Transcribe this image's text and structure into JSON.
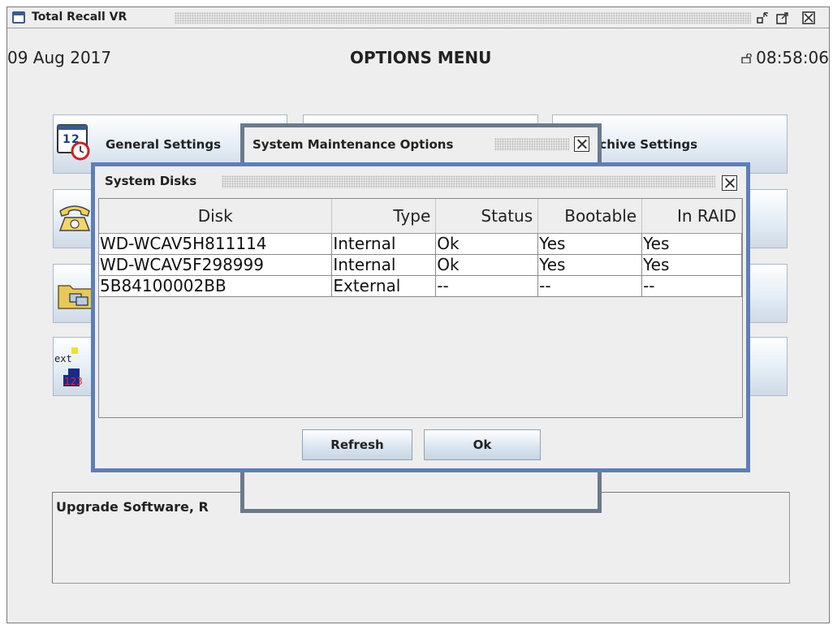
{
  "window": {
    "title": "Total Recall VR"
  },
  "header": {
    "date": "09 Aug 2017",
    "menu_title": "OPTIONS MENU",
    "time": "08:58:06"
  },
  "options": {
    "general_settings": "General Settings",
    "archive_settings": "rchive Settings"
  },
  "description": "Upgrade Software, R",
  "maintenance_dialog": {
    "title": "System Maintenance Options"
  },
  "disks_dialog": {
    "title": "System Disks",
    "columns": [
      "Disk",
      "Type",
      "Status",
      "Bootable",
      "In RAID"
    ],
    "rows": [
      [
        "WD-WCAV5H811114",
        "Internal",
        "Ok",
        "Yes",
        "Yes"
      ],
      [
        "WD-WCAV5F298999",
        "Internal",
        "Ok",
        "Yes",
        "Yes"
      ],
      [
        "5B84100002BB",
        "External",
        "--",
        "--",
        "--"
      ]
    ],
    "refresh_label": "Refresh",
    "ok_label": "Ok"
  },
  "colors": {
    "disks_border": "#5d7fb8",
    "maint_border": "#6a7a8c",
    "background": "#eeeeee"
  }
}
